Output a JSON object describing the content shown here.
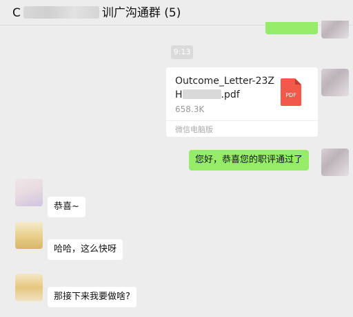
{
  "header": {
    "title_prefix": "C",
    "title_suffix": "训广沟通群 (5)"
  },
  "messages": {
    "time_badge": "9:13",
    "file": {
      "name": "Outcome_Letter-23ZH",
      "name_end": ".pdf",
      "size": "658.3K",
      "source": "微信电脑版",
      "icon_label": "PDF",
      "icon_color": "#f15a4a"
    },
    "outgoing_text": "您好，恭喜您的职评通过了",
    "incoming": [
      "恭喜~",
      "哈哈，这么快呀",
      "那接下来我要做啥?"
    ]
  },
  "colors": {
    "sent_bubble": "#95ec69",
    "received_bubble": "#ffffff",
    "background": "#ededed"
  }
}
